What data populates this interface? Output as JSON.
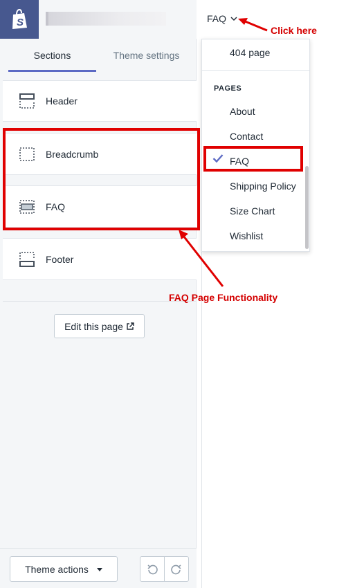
{
  "app": {
    "brand_color": "#47588f",
    "accent_color": "#5c6ac4"
  },
  "tabs": [
    {
      "label": "Sections",
      "active": true
    },
    {
      "label": "Theme settings",
      "active": false
    }
  ],
  "sections": [
    {
      "label": "Header",
      "icon": "header-section-icon"
    },
    {
      "label": "Breadcrumb",
      "icon": "dashed-section-icon"
    },
    {
      "label": "FAQ",
      "icon": "content-section-icon"
    },
    {
      "label": "Footer",
      "icon": "footer-section-icon"
    }
  ],
  "edit_button": {
    "label": "Edit this page",
    "icon": "external-link-icon"
  },
  "bottom": {
    "theme_actions_label": "Theme actions",
    "undo_icon": "undo-icon",
    "redo_icon": "redo-icon"
  },
  "page_selector": {
    "current": "FAQ",
    "icon": "chevron-down-icon"
  },
  "dropdown": {
    "top_item": "404 page",
    "heading": "PAGES",
    "items": [
      "About",
      "Contact",
      "FAQ",
      "Shipping Policy",
      "Size Chart",
      "Wishlist"
    ],
    "selected": "FAQ"
  },
  "annotations": {
    "click_here": "Click here",
    "faq_functionality": "FAQ Page Functionality",
    "color": "#e00000"
  }
}
